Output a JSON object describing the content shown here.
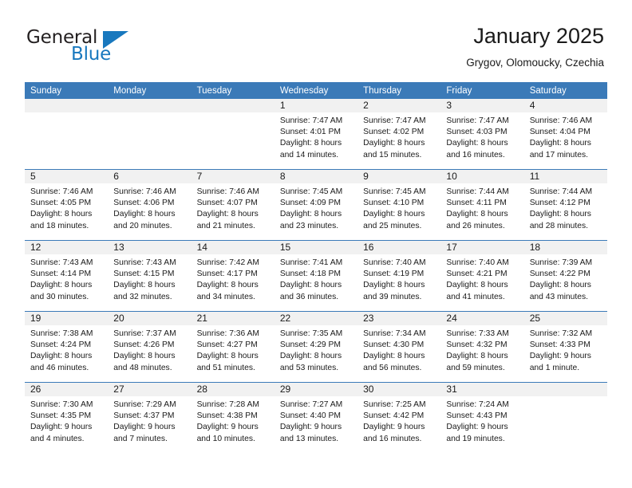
{
  "brand": {
    "name_top": "General",
    "name_bottom": "Blue",
    "triangle_icon": "blue-triangle-icon",
    "accent_color": "#1878be"
  },
  "header": {
    "title": "January 2025",
    "subtitle": "Grygov, Olomoucky, Czechia"
  },
  "theme": {
    "header_blue": "#3b7ab8",
    "daynum_band": "#f1f1f1",
    "text": "#1a1a1a"
  },
  "calendar": {
    "weekday_headers": [
      "Sunday",
      "Monday",
      "Tuesday",
      "Wednesday",
      "Thursday",
      "Friday",
      "Saturday"
    ],
    "labels": {
      "sunrise": "Sunrise:",
      "sunset": "Sunset:",
      "daylight": "Daylight:"
    },
    "weeks": [
      [
        {
          "day": "",
          "empty": true
        },
        {
          "day": "",
          "empty": true
        },
        {
          "day": "",
          "empty": true
        },
        {
          "day": "1",
          "sunrise": "Sunrise: 7:47 AM",
          "sunset": "Sunset: 4:01 PM",
          "daylight_1": "Daylight: 8 hours",
          "daylight_2": "and 14 minutes."
        },
        {
          "day": "2",
          "sunrise": "Sunrise: 7:47 AM",
          "sunset": "Sunset: 4:02 PM",
          "daylight_1": "Daylight: 8 hours",
          "daylight_2": "and 15 minutes."
        },
        {
          "day": "3",
          "sunrise": "Sunrise: 7:47 AM",
          "sunset": "Sunset: 4:03 PM",
          "daylight_1": "Daylight: 8 hours",
          "daylight_2": "and 16 minutes."
        },
        {
          "day": "4",
          "sunrise": "Sunrise: 7:46 AM",
          "sunset": "Sunset: 4:04 PM",
          "daylight_1": "Daylight: 8 hours",
          "daylight_2": "and 17 minutes."
        }
      ],
      [
        {
          "day": "5",
          "sunrise": "Sunrise: 7:46 AM",
          "sunset": "Sunset: 4:05 PM",
          "daylight_1": "Daylight: 8 hours",
          "daylight_2": "and 18 minutes."
        },
        {
          "day": "6",
          "sunrise": "Sunrise: 7:46 AM",
          "sunset": "Sunset: 4:06 PM",
          "daylight_1": "Daylight: 8 hours",
          "daylight_2": "and 20 minutes."
        },
        {
          "day": "7",
          "sunrise": "Sunrise: 7:46 AM",
          "sunset": "Sunset: 4:07 PM",
          "daylight_1": "Daylight: 8 hours",
          "daylight_2": "and 21 minutes."
        },
        {
          "day": "8",
          "sunrise": "Sunrise: 7:45 AM",
          "sunset": "Sunset: 4:09 PM",
          "daylight_1": "Daylight: 8 hours",
          "daylight_2": "and 23 minutes."
        },
        {
          "day": "9",
          "sunrise": "Sunrise: 7:45 AM",
          "sunset": "Sunset: 4:10 PM",
          "daylight_1": "Daylight: 8 hours",
          "daylight_2": "and 25 minutes."
        },
        {
          "day": "10",
          "sunrise": "Sunrise: 7:44 AM",
          "sunset": "Sunset: 4:11 PM",
          "daylight_1": "Daylight: 8 hours",
          "daylight_2": "and 26 minutes."
        },
        {
          "day": "11",
          "sunrise": "Sunrise: 7:44 AM",
          "sunset": "Sunset: 4:12 PM",
          "daylight_1": "Daylight: 8 hours",
          "daylight_2": "and 28 minutes."
        }
      ],
      [
        {
          "day": "12",
          "sunrise": "Sunrise: 7:43 AM",
          "sunset": "Sunset: 4:14 PM",
          "daylight_1": "Daylight: 8 hours",
          "daylight_2": "and 30 minutes."
        },
        {
          "day": "13",
          "sunrise": "Sunrise: 7:43 AM",
          "sunset": "Sunset: 4:15 PM",
          "daylight_1": "Daylight: 8 hours",
          "daylight_2": "and 32 minutes."
        },
        {
          "day": "14",
          "sunrise": "Sunrise: 7:42 AM",
          "sunset": "Sunset: 4:17 PM",
          "daylight_1": "Daylight: 8 hours",
          "daylight_2": "and 34 minutes."
        },
        {
          "day": "15",
          "sunrise": "Sunrise: 7:41 AM",
          "sunset": "Sunset: 4:18 PM",
          "daylight_1": "Daylight: 8 hours",
          "daylight_2": "and 36 minutes."
        },
        {
          "day": "16",
          "sunrise": "Sunrise: 7:40 AM",
          "sunset": "Sunset: 4:19 PM",
          "daylight_1": "Daylight: 8 hours",
          "daylight_2": "and 39 minutes."
        },
        {
          "day": "17",
          "sunrise": "Sunrise: 7:40 AM",
          "sunset": "Sunset: 4:21 PM",
          "daylight_1": "Daylight: 8 hours",
          "daylight_2": "and 41 minutes."
        },
        {
          "day": "18",
          "sunrise": "Sunrise: 7:39 AM",
          "sunset": "Sunset: 4:22 PM",
          "daylight_1": "Daylight: 8 hours",
          "daylight_2": "and 43 minutes."
        }
      ],
      [
        {
          "day": "19",
          "sunrise": "Sunrise: 7:38 AM",
          "sunset": "Sunset: 4:24 PM",
          "daylight_1": "Daylight: 8 hours",
          "daylight_2": "and 46 minutes."
        },
        {
          "day": "20",
          "sunrise": "Sunrise: 7:37 AM",
          "sunset": "Sunset: 4:26 PM",
          "daylight_1": "Daylight: 8 hours",
          "daylight_2": "and 48 minutes."
        },
        {
          "day": "21",
          "sunrise": "Sunrise: 7:36 AM",
          "sunset": "Sunset: 4:27 PM",
          "daylight_1": "Daylight: 8 hours",
          "daylight_2": "and 51 minutes."
        },
        {
          "day": "22",
          "sunrise": "Sunrise: 7:35 AM",
          "sunset": "Sunset: 4:29 PM",
          "daylight_1": "Daylight: 8 hours",
          "daylight_2": "and 53 minutes."
        },
        {
          "day": "23",
          "sunrise": "Sunrise: 7:34 AM",
          "sunset": "Sunset: 4:30 PM",
          "daylight_1": "Daylight: 8 hours",
          "daylight_2": "and 56 minutes."
        },
        {
          "day": "24",
          "sunrise": "Sunrise: 7:33 AM",
          "sunset": "Sunset: 4:32 PM",
          "daylight_1": "Daylight: 8 hours",
          "daylight_2": "and 59 minutes."
        },
        {
          "day": "25",
          "sunrise": "Sunrise: 7:32 AM",
          "sunset": "Sunset: 4:33 PM",
          "daylight_1": "Daylight: 9 hours",
          "daylight_2": "and 1 minute."
        }
      ],
      [
        {
          "day": "26",
          "sunrise": "Sunrise: 7:30 AM",
          "sunset": "Sunset: 4:35 PM",
          "daylight_1": "Daylight: 9 hours",
          "daylight_2": "and 4 minutes."
        },
        {
          "day": "27",
          "sunrise": "Sunrise: 7:29 AM",
          "sunset": "Sunset: 4:37 PM",
          "daylight_1": "Daylight: 9 hours",
          "daylight_2": "and 7 minutes."
        },
        {
          "day": "28",
          "sunrise": "Sunrise: 7:28 AM",
          "sunset": "Sunset: 4:38 PM",
          "daylight_1": "Daylight: 9 hours",
          "daylight_2": "and 10 minutes."
        },
        {
          "day": "29",
          "sunrise": "Sunrise: 7:27 AM",
          "sunset": "Sunset: 4:40 PM",
          "daylight_1": "Daylight: 9 hours",
          "daylight_2": "and 13 minutes."
        },
        {
          "day": "30",
          "sunrise": "Sunrise: 7:25 AM",
          "sunset": "Sunset: 4:42 PM",
          "daylight_1": "Daylight: 9 hours",
          "daylight_2": "and 16 minutes."
        },
        {
          "day": "31",
          "sunrise": "Sunrise: 7:24 AM",
          "sunset": "Sunset: 4:43 PM",
          "daylight_1": "Daylight: 9 hours",
          "daylight_2": "and 19 minutes."
        },
        {
          "day": "",
          "empty": true
        }
      ]
    ]
  }
}
